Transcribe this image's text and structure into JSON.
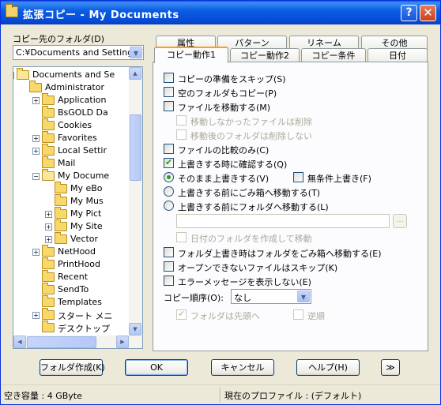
{
  "window": {
    "title": "拡張コピー - My Documents",
    "help_glyph": "?",
    "close_glyph": "✕"
  },
  "dest": {
    "label": "コピー先のフォルダ(D)",
    "path": "C:¥Documents and Settings¥"
  },
  "tree": {
    "items": [
      {
        "label": "Documents and Se",
        "expander": "−",
        "level": 1
      },
      {
        "label": "Administrator",
        "expander": "",
        "level": 2
      },
      {
        "label": "Application",
        "expander": "+",
        "level": 3
      },
      {
        "label": "BsGOLD Da",
        "expander": "",
        "level": 3
      },
      {
        "label": "Cookies",
        "expander": "",
        "level": 3
      },
      {
        "label": "Favorites",
        "expander": "+",
        "level": 3
      },
      {
        "label": "Local Settir",
        "expander": "+",
        "level": 3
      },
      {
        "label": "Mail",
        "expander": "",
        "level": 3
      },
      {
        "label": "My Docume",
        "expander": "−",
        "level": 3
      },
      {
        "label": "My eBo",
        "expander": "",
        "level": 4
      },
      {
        "label": "My Mus",
        "expander": "",
        "level": 4
      },
      {
        "label": "My Pict",
        "expander": "+",
        "level": 4
      },
      {
        "label": "My Site",
        "expander": "+",
        "level": 4
      },
      {
        "label": "Vector",
        "expander": "+",
        "level": 4
      },
      {
        "label": "NetHood",
        "expander": "+",
        "level": 3
      },
      {
        "label": "PrintHood",
        "expander": "",
        "level": 3
      },
      {
        "label": "Recent",
        "expander": "",
        "level": 3
      },
      {
        "label": "SendTo",
        "expander": "",
        "level": 3
      },
      {
        "label": "Templates",
        "expander": "",
        "level": 3
      },
      {
        "label": "スタート メニ",
        "expander": "+",
        "level": 3
      },
      {
        "label": "デスクトップ",
        "expander": "",
        "level": 3
      }
    ]
  },
  "tabs": {
    "row1": [
      "属性",
      "パターン",
      "リネーム",
      "その他"
    ],
    "row2": [
      "コピー動作1",
      "コピー動作2",
      "コピー条件",
      "日付"
    ]
  },
  "options": {
    "skip_prepare": "コピーの準備をスキップ(S)",
    "copy_empty": "空のフォルダもコピー(P)",
    "move_files": "ファイルを移動する(M)",
    "delete_unmoved": "移動しなかったファイルは削除",
    "no_delete_after_move": "移動後のフォルダは削除しない",
    "compare_only": "ファイルの比較のみ(C)",
    "confirm_overwrite": "上書きする時に確認する(Q)",
    "overwrite_as_is": "そのまま上書きする(V)",
    "unconditional": "無条件上書き(F)",
    "trash_before": "上書きする前にごみ箱へ移動する(T)",
    "folder_before": "上書きする前にフォルダへ移動する(L)",
    "dot_button": "...",
    "create_dated": "日付のフォルダを作成して移動",
    "folder_overwrite_trash": "フォルダ上書き時はフォルダをごみ箱へ移動する(E)",
    "skip_unopenable": "オープンできないファイルはスキップ(K)",
    "no_error_msg": "エラーメッセージを表示しない(E)",
    "order_label": "コピー順序(O):",
    "order_value": "なし",
    "folders_first": "フォルダは先頭へ",
    "reverse": "逆順"
  },
  "buttons": {
    "make_folder": "フォルダ作成(K)",
    "ok": "OK",
    "cancel": "キャンセル",
    "help": "ヘルプ(H)",
    "more": "≫"
  },
  "status": {
    "free_space": "空き容量 : 4 GByte",
    "profile": "現在のプロファイル : (デフォルト)"
  }
}
